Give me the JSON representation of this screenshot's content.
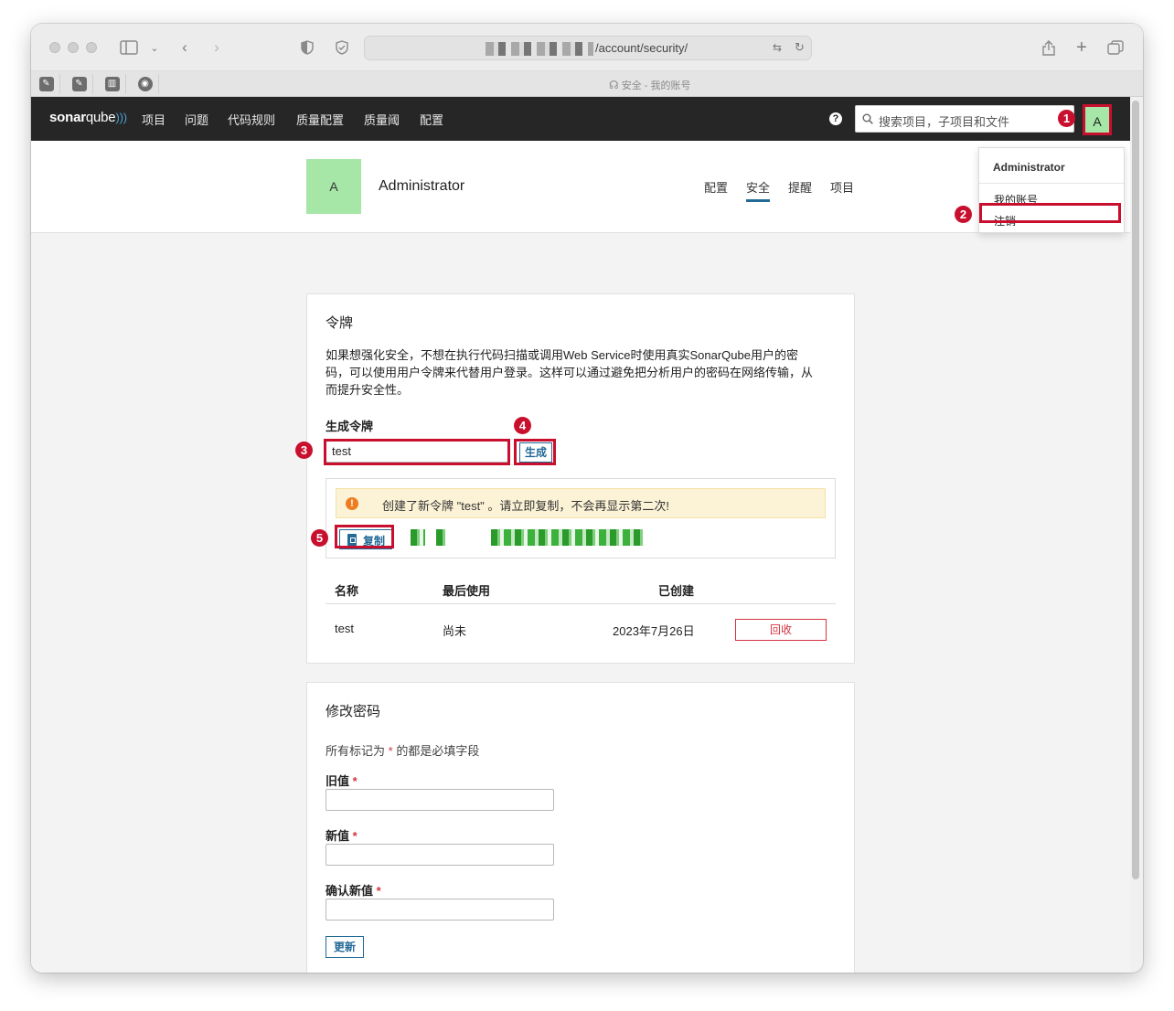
{
  "browser": {
    "url": "/account/security/",
    "tab_title": "安全 - 我的账号"
  },
  "navbar": {
    "logo": {
      "bold": "sonar",
      "rest": "qube"
    },
    "items": [
      "项目",
      "问题",
      "代码规则",
      "质量配置",
      "质量阈",
      "配置"
    ],
    "search_placeholder": "搜索项目，子项目和文件",
    "avatar_letter": "A"
  },
  "profile": {
    "avatar_letter": "A",
    "name": "Administrator",
    "tabs": [
      "配置",
      "安全",
      "提醒",
      "项目"
    ],
    "active_tab": "安全"
  },
  "dropdown": {
    "header": "Administrator",
    "items": [
      "我的账号",
      "注销"
    ]
  },
  "markers": [
    "1",
    "2",
    "3",
    "4",
    "5"
  ],
  "tokens": {
    "title": "令牌",
    "description": "如果想强化安全，不想在执行代码扫描或调用Web Service时使用真实SonarQube用户的密码，可以使用用户令牌来代替用户登录。这样可以通过避免把分析用户的密码在网络传输，从而提升安全性。",
    "generate_label": "生成令牌",
    "input_value": "test",
    "generate_button": "生成",
    "notice_icon": "!",
    "notice": "创建了新令牌 \"test\" 。请立即复制，不会再显示第二次!",
    "copy_button": "复制",
    "table": {
      "headers": {
        "name": "名称",
        "last_used": "最后使用",
        "created": "已创建"
      },
      "rows": [
        {
          "name": "test",
          "last_used": "尚未",
          "created": "2023年7月26日",
          "action": "回收"
        }
      ]
    }
  },
  "password": {
    "title": "修改密码",
    "hint_prefix": "所有标记为",
    "hint_star": "*",
    "hint_suffix": "的都是必填字段",
    "fields": [
      {
        "label": "旧值",
        "required": "*"
      },
      {
        "label": "新值",
        "required": "*"
      },
      {
        "label": "确认新值",
        "required": "*"
      }
    ],
    "submit": "更新"
  },
  "colors": {
    "accent": "#236a97",
    "danger": "#d4333f",
    "annotation_red": "#c8102e",
    "avatar_green": "#a6e6a7",
    "navbar": "#262626",
    "notice_bg": "#fcf3d6"
  }
}
